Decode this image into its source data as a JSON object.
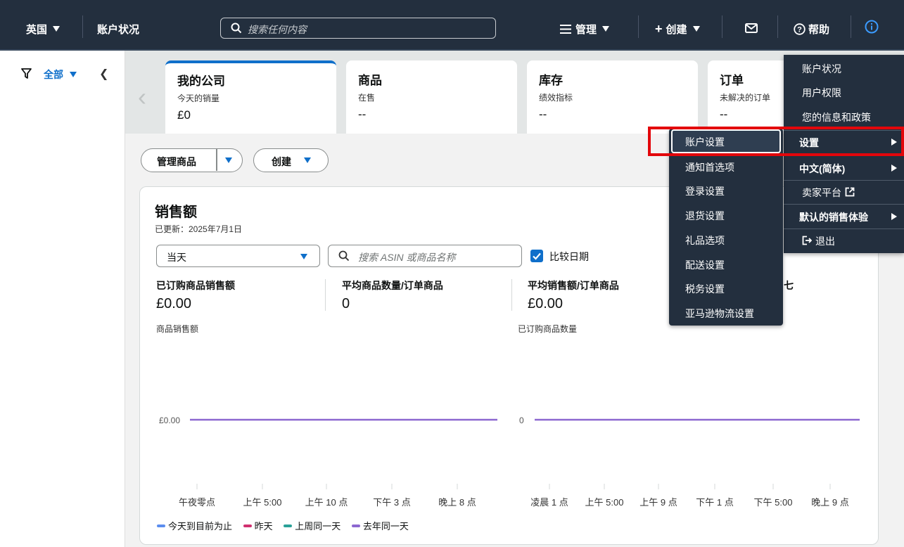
{
  "topnav": {
    "country": "英国",
    "account_health": "账户状况",
    "search_placeholder": "搜索任何内容",
    "manage": "管理",
    "create": "创建",
    "help": "帮助"
  },
  "filter": {
    "all": "全部"
  },
  "cards": [
    {
      "title": "我的公司",
      "subtitle": "今天的销量",
      "value": "£0"
    },
    {
      "title": "商品",
      "subtitle": "在售",
      "value": "--"
    },
    {
      "title": "库存",
      "subtitle": "绩效指标",
      "value": "--"
    },
    {
      "title": "订单",
      "subtitle": "未解决的订单",
      "value": "--"
    }
  ],
  "actions": {
    "manage_products": "管理商品",
    "create": "创建"
  },
  "sales": {
    "title": "销售额",
    "updated": "已更新：2025年7月1日",
    "period": "当天",
    "asin_placeholder": "搜索 ASIN 或商品名称",
    "compare_label": "比较日期",
    "metrics": [
      {
        "label": "已订购商品销售额",
        "value": "£0.00"
      },
      {
        "label": "平均商品数量/订单商品",
        "value": "0"
      },
      {
        "label": "平均销售额/订单商品",
        "value": "£0.00"
      },
      {
        "label": "七",
        "value": ""
      }
    ],
    "chart_left_label": "商品销售额",
    "chart_right_label": "已订购商品数量",
    "y_left": "£0.00",
    "y_right": "0"
  },
  "chart_data": [
    {
      "type": "line",
      "ylabel": "商品销售额",
      "categories": [
        "午夜零点",
        "上午 5:00",
        "上午 10 点",
        "下午 3 点",
        "晚上 8 点"
      ],
      "series": [
        {
          "name": "去年同一天",
          "values": [
            0,
            0,
            0,
            0,
            0
          ]
        }
      ],
      "y_tick": "£0.00",
      "color": "#8c67d0"
    },
    {
      "type": "line",
      "ylabel": "已订购商品数量",
      "categories": [
        "凌晨 1 点",
        "上午 5:00",
        "上午 9 点",
        "下午 1 点",
        "下午 5:00",
        "晚上 9 点"
      ],
      "series": [
        {
          "name": "去年同一天",
          "values": [
            0,
            0,
            0,
            0,
            0,
            0
          ]
        }
      ],
      "y_tick": "0",
      "color": "#8c67d0"
    }
  ],
  "legend": [
    {
      "label": "今天到目前为止",
      "color": "#5b8def"
    },
    {
      "label": "昨天",
      "color": "#d0306f"
    },
    {
      "label": "上周同一天",
      "color": "#2aa198"
    },
    {
      "label": "去年同一天",
      "color": "#8c67d0"
    }
  ],
  "settings_menu": {
    "items": [
      "账户状况",
      "用户权限",
      "您的信息和政策",
      "设置",
      "中文(简体)",
      "卖家平台",
      "默认的销售体验",
      "退出"
    ]
  },
  "settings_submenu": {
    "items": [
      "账户设置",
      "通知首选项",
      "登录设置",
      "退货设置",
      "礼品选项",
      "配送设置",
      "税务设置",
      "亚马逊物流设置"
    ]
  },
  "highlight_color": "#e3060b"
}
